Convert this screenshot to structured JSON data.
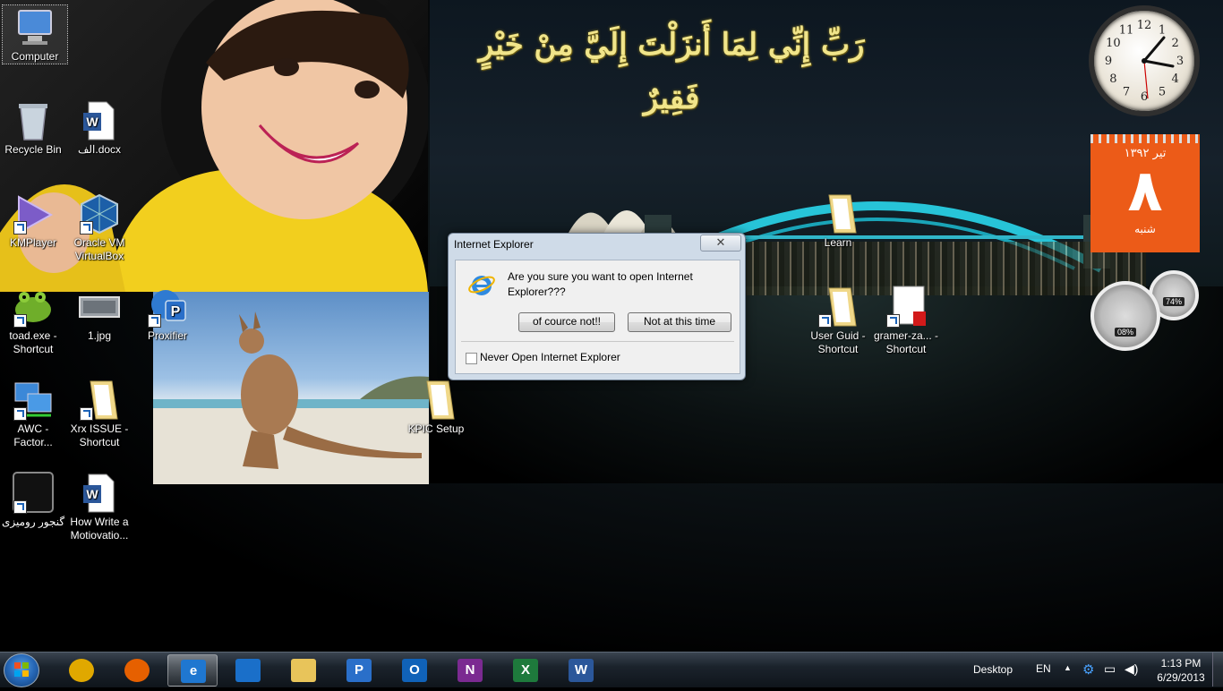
{
  "wallpaper": {
    "calligraphy": "رَبِّ إِنِّي لِمَا أَنزَلْتَ إِلَيَّ مِنْ خَيْرٍ فَقِيرٌ"
  },
  "desktop_icons": [
    {
      "label": "Computer"
    },
    {
      "label": "Recycle Bin"
    },
    {
      "label": "الف.docx"
    },
    {
      "label": "KMPlayer"
    },
    {
      "label": "Oracle VM VirtualBox"
    },
    {
      "label": "toad.exe - Shortcut"
    },
    {
      "label": "1.jpg"
    },
    {
      "label": "Proxifier"
    },
    {
      "label": "AWC - Factor..."
    },
    {
      "label": "Xrx ISSUE - Shortcut"
    },
    {
      "label": "گنجور رومیزی"
    },
    {
      "label": "How Write a Motiovatio..."
    },
    {
      "label": "KPIC Setup"
    },
    {
      "label": "Learn"
    },
    {
      "label": "User Guid - Shortcut"
    },
    {
      "label": "gramer-za... - Shortcut"
    }
  ],
  "gadgets": {
    "calendar": {
      "month": "تیر ۱۳۹۲",
      "day": "۸",
      "weekday": "شنبه"
    },
    "meters": {
      "cpu": "08%",
      "memory": "74%"
    },
    "clock": {
      "hour_numbers": [
        "12",
        "1",
        "2",
        "3",
        "4",
        "5",
        "6",
        "7",
        "8",
        "9",
        "10",
        "11"
      ]
    }
  },
  "dialog": {
    "title": "Internet Explorer",
    "close_glyph": "✕",
    "message": "Are you sure you want to open Internet Explorer???",
    "button_yes": "of cource not!!",
    "button_no": "Not at this time",
    "checkbox_label": "Never Open Internet Explorer",
    "checkbox_checked": false
  },
  "taskbar": {
    "apps": [
      {
        "name": "Google Chrome",
        "icon": "chrome-icon",
        "glyph": ""
      },
      {
        "name": "Firefox",
        "icon": "firefox-icon",
        "glyph": ""
      },
      {
        "name": "Internet Explorer",
        "icon": "ie-icon",
        "glyph": "e",
        "active": true
      },
      {
        "name": "Navigator",
        "icon": "navigator-icon",
        "glyph": ""
      },
      {
        "name": "Windows Explorer",
        "icon": "folder-icon",
        "glyph": ""
      },
      {
        "name": "Proxifier",
        "icon": "proxifier-icon",
        "glyph": "P"
      },
      {
        "name": "Outlook",
        "icon": "outlook-icon",
        "glyph": "O"
      },
      {
        "name": "OneNote",
        "icon": "onenote-icon",
        "glyph": "N"
      },
      {
        "name": "Excel",
        "icon": "excel-icon",
        "glyph": "X"
      },
      {
        "name": "Word",
        "icon": "word-icon",
        "glyph": "W"
      }
    ],
    "toolbar_label": "Desktop",
    "language": "EN",
    "time": "1:13 PM",
    "date": "6/29/2013",
    "colors": {
      "chrome": "#e0a800",
      "firefox": "#e66000",
      "ie": "#1f77d0",
      "navigator": "#1a6fc9",
      "folder": "#e8c45a",
      "proxifier": "#2a6fc9",
      "outlook": "#1062b8",
      "onenote": "#7b2a91",
      "excel": "#1e7a3c",
      "word": "#2b579a"
    }
  }
}
